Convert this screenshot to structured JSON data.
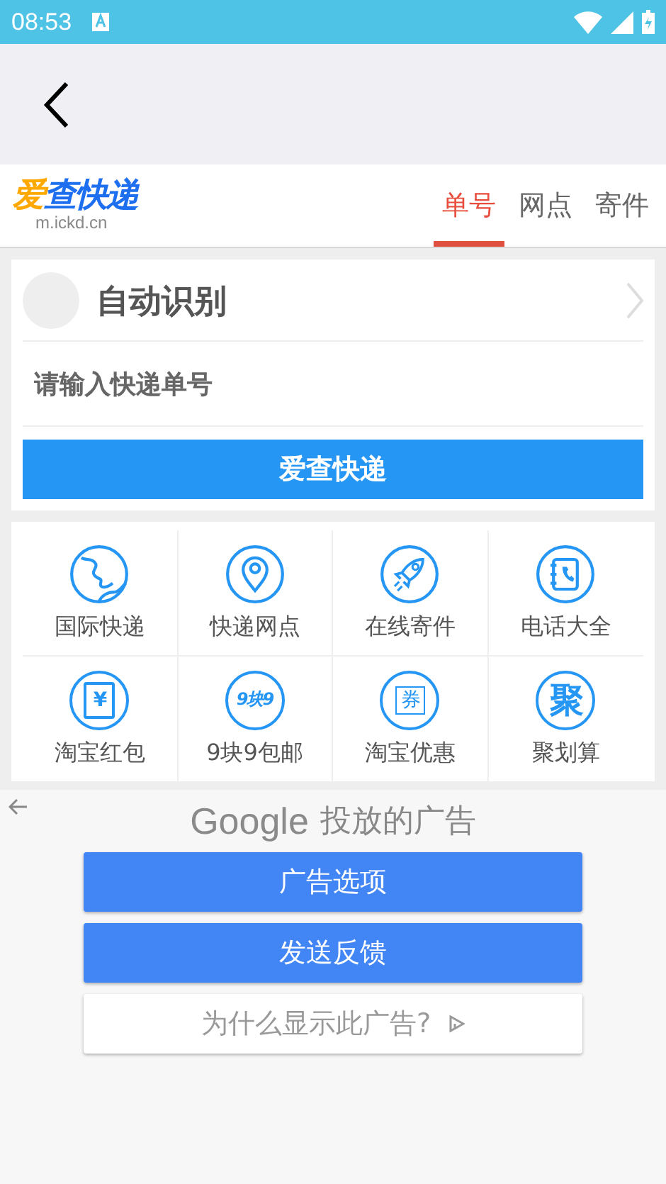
{
  "status_bar": {
    "time": "08:53"
  },
  "logo": {
    "title": "爱查快递",
    "domain": "m.ickd.cn"
  },
  "tabs": [
    {
      "label": "单号",
      "selected": true
    },
    {
      "label": "网点",
      "selected": false
    },
    {
      "label": "寄件",
      "selected": false
    }
  ],
  "query_card": {
    "carrier": "自动识别",
    "placeholder": "请输入快递单号",
    "button": "爱查快递"
  },
  "shortcuts": [
    {
      "kind": "globe",
      "label": "国际快递"
    },
    {
      "kind": "pin",
      "label": "快递网点"
    },
    {
      "kind": "rocket",
      "label": "在线寄件"
    },
    {
      "kind": "phonebook",
      "label": "电话大全"
    },
    {
      "kind": "packet",
      "icon_text": "¥",
      "label": "淘宝红包"
    },
    {
      "kind": "text",
      "icon_text": "9块9",
      "label": "9块9包邮"
    },
    {
      "kind": "coupon",
      "icon_text": "券",
      "label": "淘宝优惠"
    },
    {
      "kind": "text",
      "icon_text": "聚",
      "label": "聚划算"
    }
  ],
  "ad": {
    "brand": "Google",
    "title": "投放的广告",
    "buttons": [
      {
        "kind": "primary",
        "label": "广告选项"
      },
      {
        "kind": "primary",
        "label": "发送反馈"
      },
      {
        "kind": "secondary",
        "label": "为什么显示此广告?"
      }
    ]
  }
}
